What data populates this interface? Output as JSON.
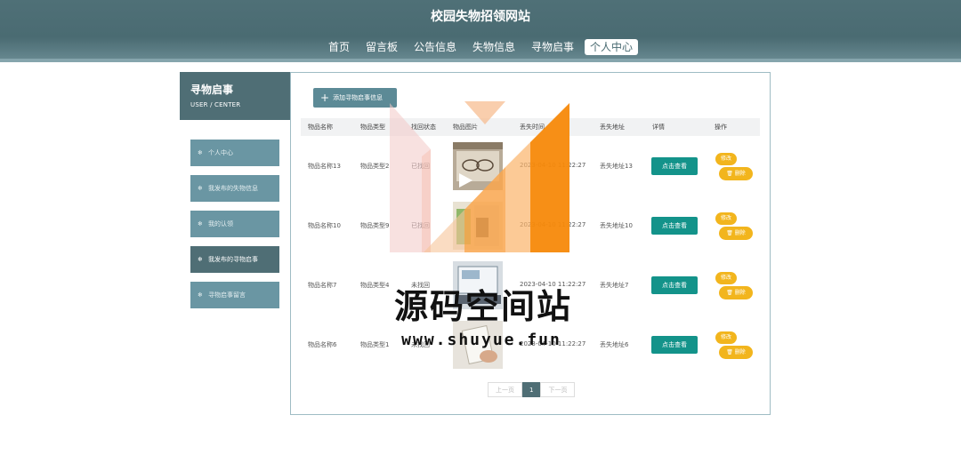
{
  "site": {
    "title": "校园失物招领网站"
  },
  "nav": {
    "items": [
      "首页",
      "留言板",
      "公告信息",
      "失物信息",
      "寻物启事",
      "个人中心"
    ],
    "active_index": 5
  },
  "sidebar": {
    "title": "寻物启事",
    "subtitle": "USER / CENTER",
    "items": [
      "个人中心",
      "我发布的失物信息",
      "我的认领",
      "我发布的寻物启事",
      "寻物启事留言"
    ],
    "active_index": 3
  },
  "actions": {
    "add_label": "添加寻物启事信息"
  },
  "table": {
    "headers": [
      "物品名称",
      "物品类型",
      "找回状态",
      "物品图片",
      "丢失时间",
      "丢失地址",
      "详情",
      "操作"
    ],
    "rows": [
      {
        "name": "物品名称13",
        "type": "物品类型2",
        "status": "已找回",
        "time": "2023-04-10 11:22:27",
        "address": "丢失地址13"
      },
      {
        "name": "物品名称10",
        "type": "物品类型9",
        "status": "已找回",
        "time": "2023-04-10 11:22:27",
        "address": "丢失地址10"
      },
      {
        "name": "物品名称7",
        "type": "物品类型4",
        "status": "未找回",
        "time": "2023-04-10 11:22:27",
        "address": "丢失地址7"
      },
      {
        "name": "物品名称6",
        "type": "物品类型1",
        "status": "未找回",
        "time": "2023-04-10 11:22:27",
        "address": "丢失地址6"
      }
    ],
    "view_label": "点击查看",
    "edit_label": "修改",
    "delete_label": "删除"
  },
  "pagination": {
    "prev": "上一页",
    "current": "1",
    "next": "下一页"
  },
  "watermark": {
    "title": "源码空间站",
    "url": "www.shuyue.fun"
  },
  "colors": {
    "header": "#4a6b72",
    "accent": "#13938a",
    "warning": "#f2b51d",
    "sidebar": "#6a96a3"
  },
  "icons": {
    "sidebar": "snowflake-icon",
    "add": "plus-icon",
    "delete": "trash-icon"
  }
}
